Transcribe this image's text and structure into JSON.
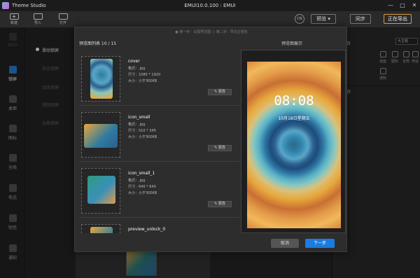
{
  "titlebar": {
    "app_title": "Theme Studio",
    "window_title": "EMUI10.0.100 : EMUI",
    "min_glyph": "—",
    "max_glyph": "□",
    "close_glyph": "✕"
  },
  "toolbar": {
    "new_label": "新建",
    "import_label": "导入",
    "open_label": "打开",
    "cn_label": "CN",
    "preview_label": "预览 ▾",
    "sync_label": "同步",
    "export_label": "正在导出"
  },
  "leftnav": {
    "items": [
      {
        "label": "AOD",
        "icon": "aod-icon"
      },
      {
        "label": "锁屏",
        "icon": "lockscreen-icon"
      },
      {
        "label": "桌面",
        "icon": "desktop-icon"
      },
      {
        "label": "图标",
        "icon": "icons-icon"
      },
      {
        "label": "全局",
        "icon": "global-icon"
      },
      {
        "label": "电话",
        "icon": "phone-icon"
      },
      {
        "label": "短信",
        "icon": "sms-icon"
      },
      {
        "label": "通知",
        "icon": "notification-icon"
      }
    ]
  },
  "subnav": {
    "items": [
      "滑动锁屏",
      "杂志锁屏",
      "动态锁屏",
      "视频锁屏",
      "全景锁屏"
    ]
  },
  "rightpanel": {
    "title": "的项目",
    "select_value": "大主题",
    "icons": [
      {
        "label": "桌面",
        "icon": "desktop-icon"
      },
      {
        "label": "图标",
        "icon": "icons-icon"
      },
      {
        "label": "全局",
        "icon": "global-icon"
      },
      {
        "label": "电话",
        "icon": "phone-icon"
      },
      {
        "label": "通知",
        "icon": "notification-icon"
      }
    ],
    "sub_title": "的内容"
  },
  "modal": {
    "steps": "● 第一步：设置预览图 ○ 第二步：导出主题包",
    "list_header": "预览图列表 10 / 15",
    "preview_header": "预览图展示",
    "rows": [
      {
        "name": "cover",
        "format": "格式：.jpg",
        "size": "尺寸：1080 * 1920",
        "filesize": "大小：小于300KB",
        "edit": "更改"
      },
      {
        "name": "icon_small",
        "format": "格式：.jpg",
        "size": "尺寸：510 * 345",
        "filesize": "大小：小于300KB",
        "edit": "更改"
      },
      {
        "name": "icon_small_1",
        "format": "格式：.jpg",
        "size": "尺寸：640 * 640",
        "filesize": "大小：小于300KB",
        "edit": "更改"
      },
      {
        "name": "preview_unlock_0",
        "format": "",
        "size": "",
        "filesize": "",
        "edit": ""
      }
    ],
    "preview": {
      "time": "08:08",
      "date": "10月18日星期五"
    },
    "cancel_label": "取消",
    "next_label": "下一步"
  }
}
